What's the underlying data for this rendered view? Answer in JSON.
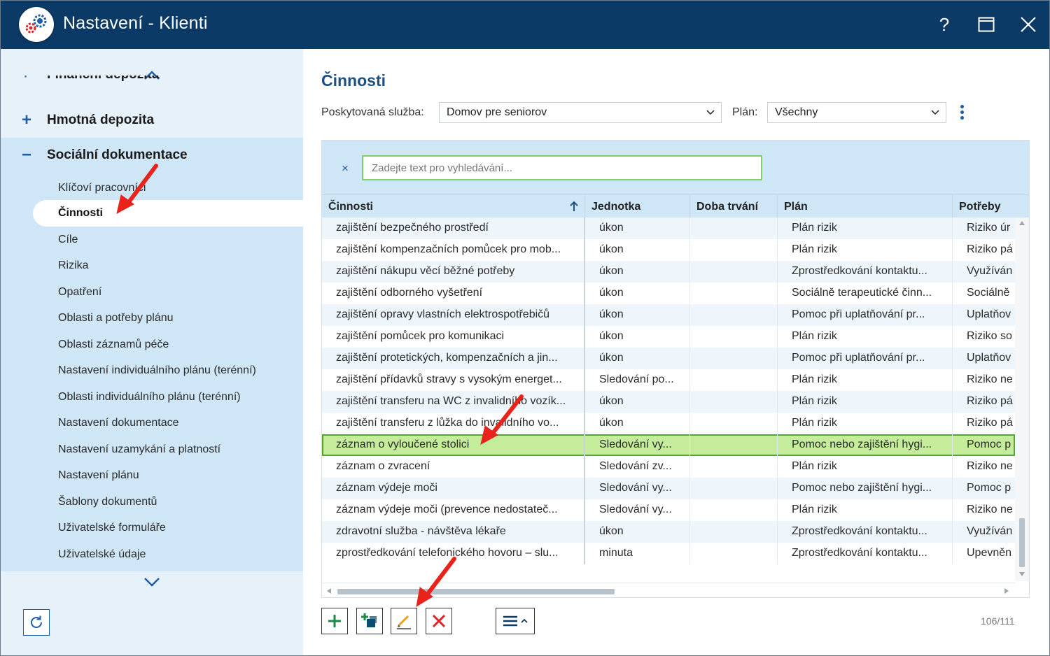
{
  "window": {
    "title": "Nastavení - Klienti",
    "help_icon": "?",
    "accent": "#0b3a66"
  },
  "sidebar": {
    "clipped_item": "Finanční depozita",
    "groups": [
      {
        "sign": "+",
        "label": "Hmotná depozita"
      },
      {
        "sign": "−",
        "label": "Sociální dokumentace"
      }
    ],
    "items": [
      "Klíčoví pracovníci",
      "Činnosti",
      "Cíle",
      "Rizika",
      "Opatření",
      "Oblasti a potřeby plánu",
      "Oblasti záznamů péče",
      "Nastavení individuálního plánu (terénní)",
      "Oblasti individuálního plánu (terénní)",
      "Nastavení dokumentace",
      "Nastavení uzamykání a platností",
      "Nastavení plánu",
      "Šablony dokumentů",
      "Uživatelské formuláře",
      "Uživatelské údaje"
    ]
  },
  "main": {
    "title": "Činnosti",
    "service_label": "Poskytovaná služba:",
    "service_value": "Domov pre seniorov",
    "plan_label": "Plán:",
    "plan_value": "Všechny",
    "search_placeholder": "Zadejte text pro vyhledávání...",
    "search_clear": "×",
    "columns": [
      "Činnosti",
      "Jednotka",
      "Doba trvání",
      "Plán",
      "Potřeby"
    ],
    "rows": [
      [
        "zajištění bezpečného prostředí",
        "úkon",
        "",
        "Plán rizik",
        "Riziko úr"
      ],
      [
        "zajištění kompenzačních pomůcek pro mob...",
        "úkon",
        "",
        "Plán rizik",
        "Riziko pá"
      ],
      [
        "zajištění nákupu věcí běžné potřeby",
        "úkon",
        "",
        "Zprostředkování kontaktu...",
        "Využíván"
      ],
      [
        "zajištění odborného vyšetření",
        "úkon",
        "",
        "Sociálně terapeutické činn...",
        "Sociálně"
      ],
      [
        "zajištění opravy vlastních elektrospotřebičů",
        "úkon",
        "",
        "Pomoc při uplatňování pr...",
        "Uplatňov"
      ],
      [
        "zajištění pomůcek pro komunikaci",
        "úkon",
        "",
        "Plán rizik",
        "Riziko so"
      ],
      [
        "zajištění protetických, kompenzačních a jin...",
        "úkon",
        "",
        "Pomoc při uplatňování pr...",
        "Uplatňov"
      ],
      [
        "zajištění přídavků stravy s vysokým energet...",
        "Sledování po...",
        "",
        "Plán rizik",
        "Riziko ne"
      ],
      [
        "zajištění transferu na WC z invalidního vozík...",
        "úkon",
        "",
        "Plán rizik",
        "Riziko pá"
      ],
      [
        "zajištění transferu z lůžka do invalidního vo...",
        "úkon",
        "",
        "Plán rizik",
        "Riziko pá"
      ],
      [
        "záznam o vyloučené stolici",
        "Sledování vy...",
        "",
        "Pomoc nebo zajištění hygi...",
        "Pomoc p"
      ],
      [
        "záznam o zvracení",
        "Sledování zv...",
        "",
        "Plán rizik",
        "Riziko ne"
      ],
      [
        "záznam výdeje moči",
        "Sledování vy...",
        "",
        "Pomoc nebo zajištění hygi...",
        "Pomoc p"
      ],
      [
        "záznam výdeje moči (prevence nedostateč...",
        "Sledování vy...",
        "",
        "Plán rizik",
        "Riziko ne"
      ],
      [
        "zdravotní služba - návštěva lékaře",
        "úkon",
        "",
        "Zprostředkování kontaktu...",
        "Využíván"
      ],
      [
        "zprostředkování telefonického hovoru – slu...",
        "minuta",
        "",
        "Zprostředkování kontaktu...",
        "Upevněn"
      ]
    ],
    "selected_row_index": 10,
    "record_count": "106/111"
  },
  "colors": {
    "selected_row": "#c4ec9a",
    "sidebar_bg": "#cfe6f6",
    "annotation_arrow": "#e8231b"
  }
}
